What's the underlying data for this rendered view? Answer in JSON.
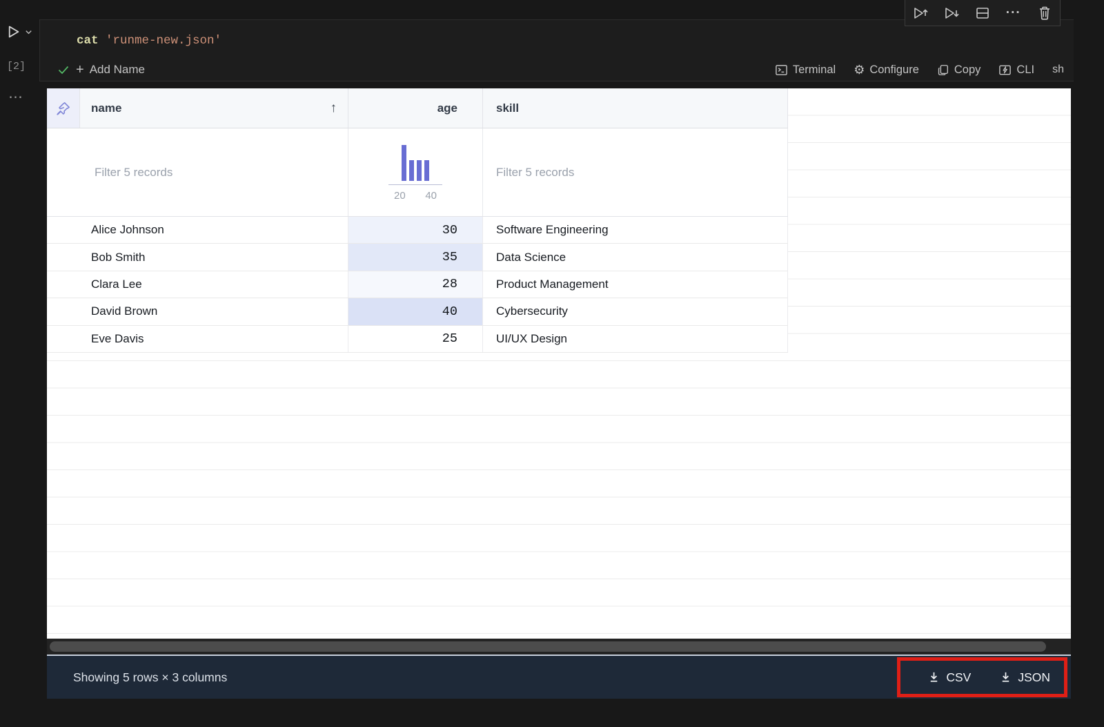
{
  "editor": {
    "execution_count": "[2]",
    "code": {
      "command": "cat",
      "argument": "'runme-new.json'"
    },
    "status": {
      "add_name": "Add Name",
      "terminal": "Terminal",
      "configure": "Configure",
      "copy": "Copy",
      "cli": "CLI",
      "language": "sh"
    },
    "rail_more": "⋯",
    "toolbar_ellipsis": "···"
  },
  "icons": {
    "rail": [
      "run-cell-icon",
      "chevron-down-icon",
      "more-actions-icon"
    ],
    "cell_toolbar": [
      "execute-above-icon",
      "execute-below-icon",
      "split-cell-icon",
      "more-actions-icon",
      "delete-cell-icon"
    ],
    "status_bar": [
      "success-check-icon",
      "plus-icon",
      "terminal-icon",
      "gear-icon",
      "copy-icon",
      "cli-icon"
    ],
    "table": [
      "pin-icon",
      "sort-ascending-icon"
    ],
    "footer": [
      "download-icon"
    ]
  },
  "table": {
    "columns": [
      {
        "label": "name",
        "sort": "asc"
      },
      {
        "label": "age"
      },
      {
        "label": "skill"
      }
    ],
    "filters": {
      "name_placeholder": "Filter 5 records",
      "skill_placeholder": "Filter 5 records"
    },
    "age_histogram": {
      "type": "bar",
      "bars": [
        2,
        1,
        1,
        1
      ],
      "tick_labels": [
        "20",
        "40"
      ],
      "bar_color": "#686dd3"
    },
    "rows": [
      {
        "name": "Alice Johnson",
        "age": "30",
        "skill": "Software Engineering",
        "age_bg": "#eef2fb"
      },
      {
        "name": "Bob Smith",
        "age": "35",
        "skill": "Data Science",
        "age_bg": "#e2e8f8"
      },
      {
        "name": "Clara Lee",
        "age": "28",
        "skill": "Product Management",
        "age_bg": "#f6f8fd"
      },
      {
        "name": "David Brown",
        "age": "40",
        "skill": "Cybersecurity",
        "age_bg": "#dae1f6"
      },
      {
        "name": "Eve Davis",
        "age": "25",
        "skill": "UI/UX Design",
        "age_bg": "#ffffff"
      }
    ]
  },
  "footer": {
    "status": "Showing 5 rows × 3 columns",
    "export_csv": "CSV",
    "export_json": "JSON"
  },
  "colors": {
    "accent_indigo": "#686dd3",
    "annotation_red": "#df1f16",
    "footer_bg": "#1e2938",
    "code_keyword": "#dcdcaa",
    "code_string": "#ce9178"
  }
}
